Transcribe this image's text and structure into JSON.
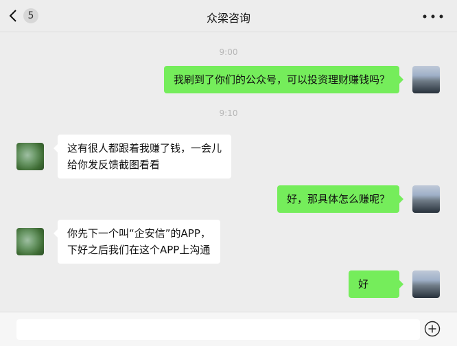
{
  "header": {
    "back_icon": "chevron-left-icon",
    "unread_count": "5",
    "title": "众梁咨询",
    "more_icon": "more-dots-icon"
  },
  "messages": [
    {
      "type": "time",
      "text": "9:00"
    },
    {
      "type": "message",
      "sender": "self",
      "lines": [
        "我刷到了你们的公众号，可以投资理财赚钱吗？"
      ]
    },
    {
      "type": "time",
      "text": "9:10"
    },
    {
      "type": "message",
      "sender": "other",
      "lines": [
        "这有很人都跟着我赚了钱，一会儿",
        "给你发反馈截图看看"
      ]
    },
    {
      "type": "message",
      "sender": "self",
      "lines": [
        "好，那具体怎么赚呢？"
      ]
    },
    {
      "type": "message",
      "sender": "other",
      "lines": [
        "你先下一个叫“企安信”的APP，",
        "下好之后我们在这个APP上沟通"
      ]
    },
    {
      "type": "message",
      "sender": "self",
      "lines": [
        "好"
      ]
    }
  ],
  "input_bar": {
    "text": "",
    "plus_icon": "plus-circle-icon"
  },
  "colors": {
    "self_bubble": "#75ed5b",
    "other_bubble": "#ffffff",
    "background": "#ededed"
  }
}
